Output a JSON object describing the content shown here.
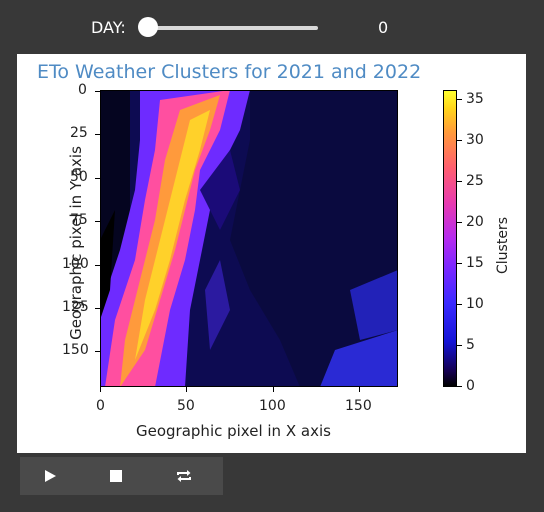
{
  "slider": {
    "label": "DAY:",
    "value": "0",
    "level": 0
  },
  "figure": {
    "title": "ETo Weather Clusters for 2021 and 2022",
    "x_axis_title": "Geographic pixel in X axis",
    "y_axis_title": "Geographic pixel in Y axis",
    "x_ticks": [
      "0",
      "50",
      "100",
      "150"
    ],
    "y_ticks": [
      "0",
      "25",
      "50",
      "75",
      "100",
      "125",
      "150"
    ],
    "colorbar_title": "Clusters",
    "colorbar_ticks": [
      "0",
      "5",
      "10",
      "15",
      "20",
      "25",
      "30",
      "35"
    ]
  },
  "controls": {
    "play_icon": "play-icon",
    "stop_icon": "stop-icon",
    "loop_icon": "loop-icon"
  },
  "colors": {
    "background": "#383838",
    "title": "#4f8bc4"
  }
}
